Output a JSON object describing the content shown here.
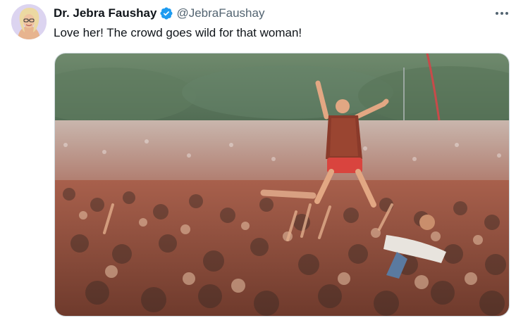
{
  "tweet": {
    "author": {
      "display_name": "Dr. Jebra Faushay",
      "handle": "@JebraFaushay",
      "verified": true,
      "avatar_icon": "avatar-portrait-icon"
    },
    "text": "Love her! The crowd goes wild for that woman!",
    "more_icon": "more-options-icon",
    "media": {
      "kind": "photo",
      "subject": "crowd-surfer-over-festival-crowd"
    }
  },
  "colors": {
    "verified_badge": "#1d9bf0",
    "handle_text": "#536471",
    "body_text": "#0f1419",
    "media_border": "#cfd9de"
  }
}
